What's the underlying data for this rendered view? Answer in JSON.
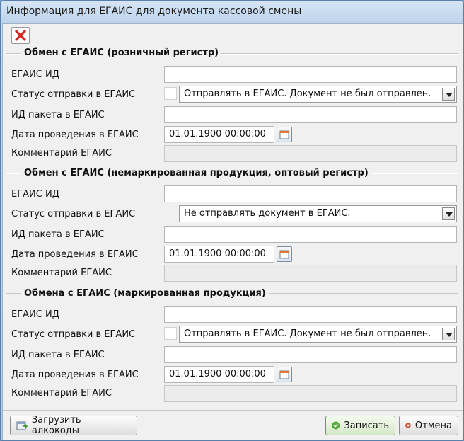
{
  "window": {
    "title": "Информация для ЕГАИС для документа кассовой смены"
  },
  "toolbar": {
    "delete_icon": "delete-x-icon"
  },
  "field_labels": {
    "egais_id": "ЕГАИС ИД",
    "send_status": "Статус отправки в ЕГАИС",
    "package_id": "ИД пакета в ЕГАИС",
    "posting_date": "Дата проведения в ЕГАИС",
    "comment": "Комментарий ЕГАИС"
  },
  "sections": [
    {
      "title": "Обмен с ЕГАИС  (розничный регистр)",
      "egais_id": "",
      "status": "Отправлять в ЕГАИС. Документ не был отправлен.",
      "package_id": "",
      "date": "01.01.1900 00:00:00",
      "comment": ""
    },
    {
      "title": "Обмен с ЕГАИС  (немаркированная продукция, оптовый регистр)",
      "egais_id": "",
      "status": "Не отправлять документ в ЕГАИС.",
      "package_id": "",
      "date": "01.01.1900 00:00:00",
      "comment": ""
    },
    {
      "title": "Обмена с ЕГАИС (маркированная продукция)",
      "egais_id": "",
      "status": "Отправлять в ЕГАИС. Документ не был отправлен.",
      "package_id": "",
      "date": "01.01.1900 00:00:00",
      "comment": ""
    }
  ],
  "footer": {
    "load_label": "Загрузить алкокоды",
    "save_label": "Записать",
    "cancel_label": "Отмена"
  },
  "colors": {
    "accent_save": "#4fa23a",
    "accent_cancel": "#d23a1e",
    "delete_red": "#d8241a"
  }
}
